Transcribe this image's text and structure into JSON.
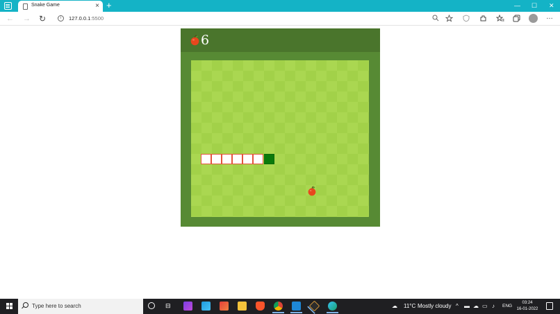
{
  "browser": {
    "tab_title": "Snake Game",
    "tab_close": "×",
    "new_tab": "+",
    "url_host": "127.0.0.1",
    "url_port": ":5500",
    "window_controls": {
      "minimize": "—",
      "maximize": "☐",
      "close": "✕"
    },
    "nav": {
      "back": "←",
      "forward": "→",
      "reload": "↻"
    },
    "icons": [
      "zoom-icon",
      "favorite-add-icon",
      "shield-icon",
      "extensions-icon",
      "favorites-icon",
      "collections-icon",
      "profile-icon",
      "more-icon"
    ]
  },
  "game": {
    "score": "6",
    "colors": {
      "frame": "#578a34",
      "header": "#4a752c",
      "board_light": "#aad751",
      "board_dark": "#a2d149",
      "snake_body": "#ffffff",
      "snake_outline": "#e5533c",
      "snake_head": "#0b7a0b",
      "apple": "#e7471d"
    },
    "snake_length": 7,
    "direction": "right"
  },
  "taskbar": {
    "search_placeholder": "Type here to search",
    "pinned_apps": [
      "cortana-icon",
      "task-view-icon",
      "affinity-photo-icon",
      "affinity-designer-icon",
      "affinity-publisher-icon",
      "file-explorer-icon",
      "brave-icon",
      "chrome-icon",
      "vscode-icon",
      "git-icon",
      "edge-icon"
    ],
    "weather_temp": "11°C",
    "weather_text": "Mostly cloudy",
    "language": "ENG",
    "time": "03:24",
    "date": "16-01-2022"
  }
}
